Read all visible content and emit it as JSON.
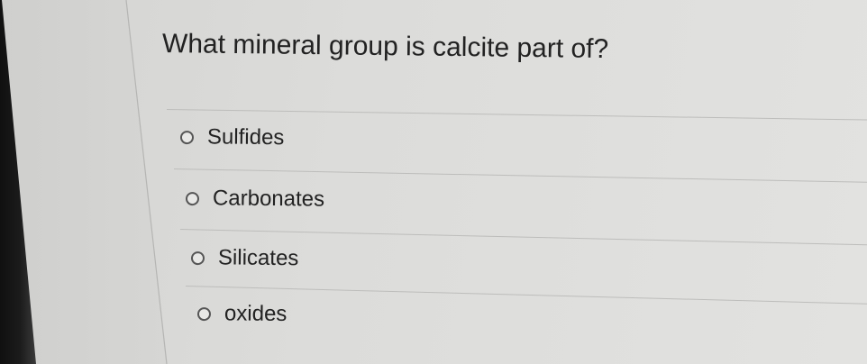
{
  "question": {
    "text": "What mineral group is calcite part of?"
  },
  "options": [
    {
      "label": "Sulfides",
      "selected": false
    },
    {
      "label": "Carbonates",
      "selected": false
    },
    {
      "label": "Silicates",
      "selected": false
    },
    {
      "label": "oxides",
      "selected": false
    }
  ],
  "colors": {
    "background": "#dcdcda",
    "text": "#222222",
    "radio_border": "#555555",
    "divider": "#bdbdbb"
  }
}
